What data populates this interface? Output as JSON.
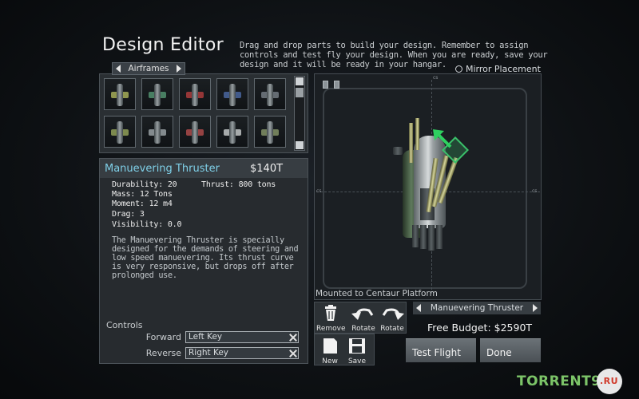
{
  "header": {
    "title": "Design Editor",
    "instructions": "Drag and drop parts to build your design. Remember to assign controls and test fly your design. When you are ready, save your design and it will be ready in your hangar."
  },
  "mirror_placement": {
    "label": "Mirror Placement",
    "selected": false
  },
  "airframes": {
    "tab_label": "Airframes",
    "items": [
      {
        "accent": "#b8c060"
      },
      {
        "accent": "#5aa07a"
      },
      {
        "accent": "#c04040"
      },
      {
        "accent": "#5070b0"
      },
      {
        "accent": "#808890"
      },
      {
        "accent": "#a0b060"
      },
      {
        "accent": "#a8b0b4"
      },
      {
        "accent": "#c05050"
      },
      {
        "accent": "#d8dcdc"
      },
      {
        "accent": "#90a070"
      }
    ]
  },
  "part": {
    "name": "Manuevering Thruster",
    "price": "$140T",
    "stats": {
      "durability": "Durability: 20",
      "thrust": "Thrust: 800 tons",
      "mass": "Mass: 12 Tons",
      "moment": "Moment: 12 m4",
      "drag": "Drag: 3",
      "visibility": "Visibility: 0.0"
    },
    "description": "The Manuevering Thruster is specially designed for the demands of steering and low speed manuevering. Its thrust curve is very responsive, but drops off after prolonged use."
  },
  "controls": {
    "label": "Controls",
    "forward_label": "Forward",
    "forward_value": "Left Key",
    "reverse_label": "Reverse",
    "reverse_value": "Right Key"
  },
  "viewport": {
    "mounted_text": "Mounted to Centaur Platform",
    "axis_label": "cs"
  },
  "tools": {
    "remove": "Remove",
    "rotate_left": "Rotate",
    "rotate_right": "Rotate",
    "new": "New",
    "save": "Save"
  },
  "selected_part": "Manuevering Thruster",
  "budget": "Free Budget: $2590T",
  "buttons": {
    "test_flight": "Test Flight",
    "done": "Done"
  },
  "watermark": {
    "main": "TORRENT9",
    "suffix": ".RU"
  },
  "colors": {
    "accent_cyan": "#7fd0e8",
    "panel": "#272b2f",
    "highlight_green": "#3ac06a"
  }
}
